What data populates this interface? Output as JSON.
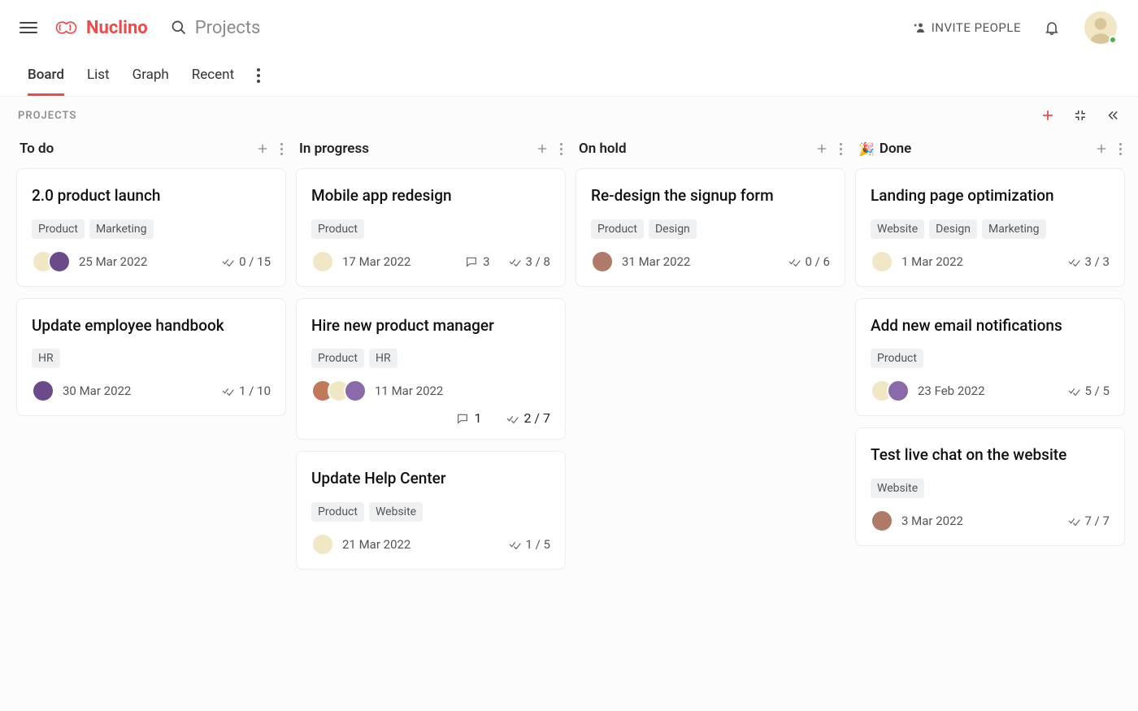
{
  "app": {
    "name": "Nuclino",
    "search_placeholder": "Projects",
    "invite_label": "INVITE PEOPLE"
  },
  "tabs": {
    "items": [
      {
        "label": "Board",
        "active": true
      },
      {
        "label": "List",
        "active": false
      },
      {
        "label": "Graph",
        "active": false
      },
      {
        "label": "Recent",
        "active": false
      }
    ]
  },
  "breadcrumb": "PROJECTS",
  "columns": [
    {
      "id": "todo",
      "title": "To do",
      "emoji": "",
      "cards": [
        {
          "title": "2.0 product launch",
          "tags": [
            "Product",
            "Marketing"
          ],
          "avatars": [
            "a1",
            "a2"
          ],
          "date": "25 Mar 2022",
          "comments": null,
          "checklist": "0 / 15"
        },
        {
          "title": "Update employee handbook",
          "tags": [
            "HR"
          ],
          "avatars": [
            "a2"
          ],
          "date": "30 Mar 2022",
          "comments": null,
          "checklist": "1 / 10"
        }
      ]
    },
    {
      "id": "inprogress",
      "title": "In progress",
      "emoji": "",
      "cards": [
        {
          "title": "Mobile app redesign",
          "tags": [
            "Product"
          ],
          "avatars": [
            "a1"
          ],
          "date": "17 Mar 2022",
          "comments": "3",
          "checklist": "3 / 8"
        },
        {
          "title": "Hire new product manager",
          "tags": [
            "Product",
            "HR"
          ],
          "avatars": [
            "a3",
            "a1",
            "a4"
          ],
          "date": "11 Mar 2022",
          "comments": "1",
          "checklist": "2 / 7",
          "twoRow": true
        },
        {
          "title": "Update Help Center",
          "tags": [
            "Product",
            "Website"
          ],
          "avatars": [
            "a1"
          ],
          "date": "21 Mar 2022",
          "comments": null,
          "checklist": "1 / 5"
        }
      ]
    },
    {
      "id": "onhold",
      "title": "On hold",
      "emoji": "",
      "cards": [
        {
          "title": "Re-design the signup form",
          "tags": [
            "Product",
            "Design"
          ],
          "avatars": [
            "a5"
          ],
          "date": "31 Mar 2022",
          "comments": null,
          "checklist": "0 / 6"
        }
      ]
    },
    {
      "id": "done",
      "title": "Done",
      "emoji": "🎉",
      "cards": [
        {
          "title": "Landing page optimization",
          "tags": [
            "Website",
            "Design",
            "Marketing"
          ],
          "avatars": [
            "a1"
          ],
          "date": "1 Mar 2022",
          "comments": null,
          "checklist": "3 / 3"
        },
        {
          "title": "Add new email notifications",
          "tags": [
            "Product"
          ],
          "avatars": [
            "a1",
            "a4"
          ],
          "date": "23 Feb 2022",
          "comments": null,
          "checklist": "5 / 5"
        },
        {
          "title": "Test live chat on the website",
          "tags": [
            "Website"
          ],
          "avatars": [
            "a5"
          ],
          "date": "3 Mar 2022",
          "comments": null,
          "checklist": "7 / 7"
        }
      ]
    }
  ]
}
